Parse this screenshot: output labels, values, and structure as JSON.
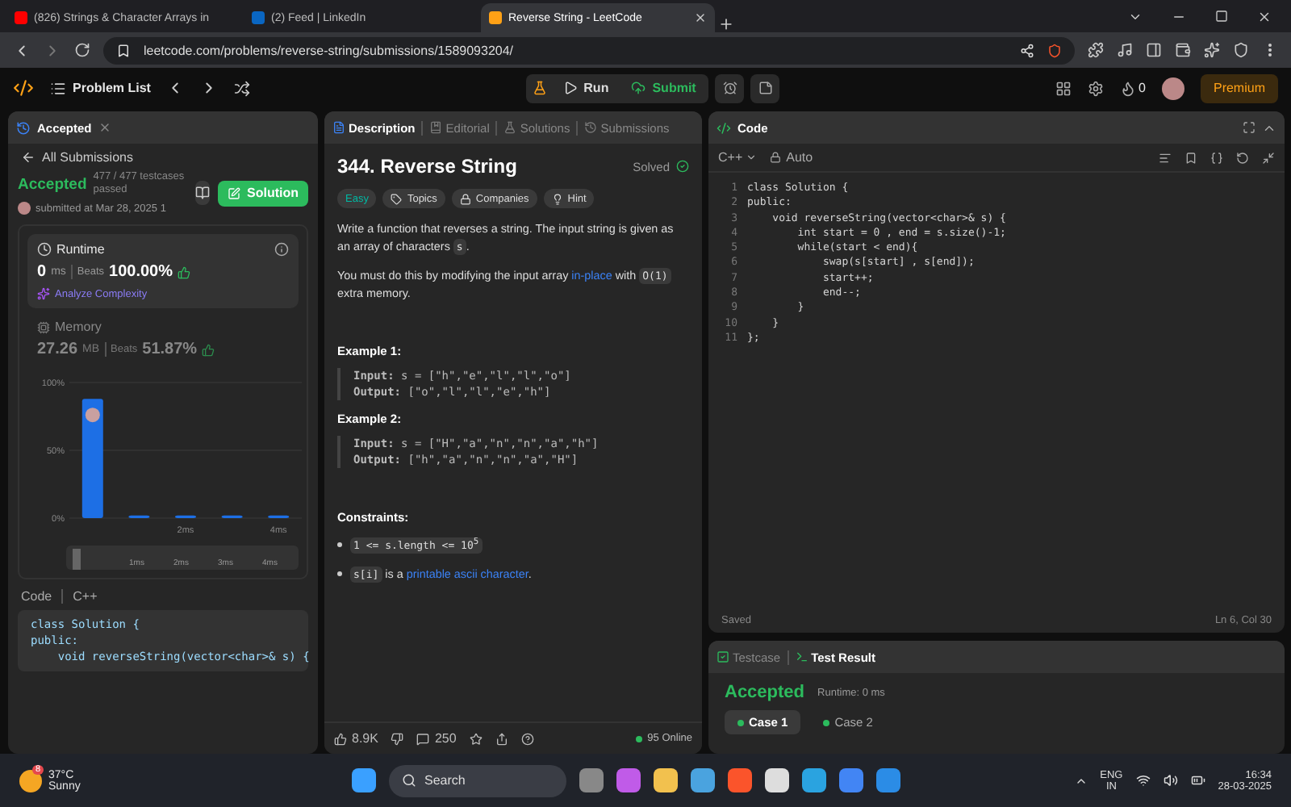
{
  "browser": {
    "tabs": [
      {
        "title": "(826) Strings & Character Arrays in",
        "selected": false
      },
      {
        "title": "(2) Feed | LinkedIn",
        "selected": false
      },
      {
        "title": "Reverse String - LeetCode",
        "selected": true
      }
    ],
    "url": "leetcode.com/problems/reverse-string/submissions/1589093204/"
  },
  "topbar": {
    "problem_list": "Problem List",
    "run": "Run",
    "submit": "Submit",
    "streak": "0",
    "premium": "Premium"
  },
  "submission": {
    "tab": "Accepted",
    "back": "All Submissions",
    "status": "Accepted",
    "testcases": "477 / 477 testcases passed",
    "submitted": "submitted at Mar 28, 2025 1",
    "solution": "Solution",
    "runtime": {
      "title": "Runtime",
      "value": "0",
      "unit": "ms",
      "beats_label": "Beats",
      "beats": "100.00%",
      "analyze": "Analyze Complexity"
    },
    "memory": {
      "title": "Memory",
      "value": "27.26",
      "unit": "MB",
      "beats_label": "Beats",
      "beats": "51.87%"
    },
    "chart_data": {
      "type": "bar",
      "values": [
        88,
        2,
        2,
        2,
        2
      ],
      "categories": [
        null,
        null,
        "2ms",
        null,
        "4ms"
      ],
      "yticks": [
        {
          "value": 0,
          "label": "0%"
        },
        {
          "value": 50,
          "label": "50%"
        },
        {
          "value": 100,
          "label": "100%"
        }
      ],
      "ylim": [
        0,
        100
      ]
    },
    "range_labels": [
      "1ms",
      "2ms",
      "3ms",
      "4ms"
    ],
    "code_tabs": [
      "Code",
      "C++"
    ],
    "code_lines": [
      "class Solution {",
      "public:",
      "    void reverseString(vector<char>& s) {"
    ]
  },
  "description": {
    "tabs": [
      {
        "label": "Description",
        "selected": true
      },
      {
        "label": "Editorial",
        "selected": false
      },
      {
        "label": "Solutions",
        "selected": false
      },
      {
        "label": "Submissions",
        "selected": false
      }
    ],
    "title": "344. Reverse String",
    "solved": "Solved",
    "tags": [
      {
        "label": "Easy",
        "kind": "difficulty"
      },
      {
        "label": "Topics",
        "kind": "topics"
      },
      {
        "label": "Companies",
        "kind": "companies"
      },
      {
        "label": "Hint",
        "kind": "hint"
      }
    ],
    "paragraphs": [
      [
        {
          "kind": "text",
          "text": "Write a function that reverses a string. The input string is given as an array of characters "
        },
        {
          "kind": "code",
          "text": "s"
        },
        {
          "kind": "text",
          "text": "."
        }
      ],
      [
        {
          "kind": "text",
          "text": "You must do this by modifying the input array "
        },
        {
          "kind": "link",
          "text": "in-place"
        },
        {
          "kind": "text",
          "text": " with "
        },
        {
          "kind": "code",
          "text": "O(1)"
        },
        {
          "kind": "text",
          "text": " extra memory."
        }
      ]
    ],
    "examples": [
      {
        "title": "Example 1:",
        "input_label": "Input:",
        "input": "s = [\"h\",\"e\",\"l\",\"l\",\"o\"]",
        "output_label": "Output:",
        "output": "[\"o\",\"l\",\"l\",\"e\",\"h\"]"
      },
      {
        "title": "Example 2:",
        "input_label": "Input:",
        "input": "s = [\"H\",\"a\",\"n\",\"n\",\"a\",\"h\"]",
        "output_label": "Output:",
        "output": "[\"h\",\"a\",\"n\",\"n\",\"a\",\"H\"]"
      }
    ],
    "constraints_title": "Constraints:",
    "constraints": [
      [
        {
          "kind": "code",
          "text": "1 <= s.length <= 10$^{5}$"
        }
      ],
      [
        {
          "kind": "code",
          "text": "s[i]"
        },
        {
          "kind": "text",
          "text": " is a "
        },
        {
          "kind": "link",
          "text": "printable ascii character"
        },
        {
          "kind": "text",
          "text": "."
        }
      ]
    ],
    "likes": "8.9K",
    "comments": "250",
    "online": "95 Online"
  },
  "editor": {
    "title": "Code",
    "language": "C++",
    "mode": "Auto",
    "lines": [
      {
        "number": "1",
        "text": "class Solution {"
      },
      {
        "number": "2",
        "text": "public:"
      },
      {
        "number": "3",
        "text": "    void reverseString(vector<char>& s) {"
      },
      {
        "number": "4",
        "text": "        int start = 0 , end = s.size()-1;"
      },
      {
        "number": "5",
        "text": "        while(start < end){"
      },
      {
        "number": "6",
        "text": "            swap(s[start] , s[end]);"
      },
      {
        "number": "7",
        "text": "            start++;"
      },
      {
        "number": "8",
        "text": "            end--;"
      },
      {
        "number": "9",
        "text": "        }"
      },
      {
        "number": "10",
        "text": "    }"
      },
      {
        "number": "11",
        "text": "};"
      }
    ],
    "status": "Saved",
    "cursor": "Ln 6, Col 30"
  },
  "result": {
    "tabs": [
      {
        "label": "Testcase",
        "selected": false
      },
      {
        "label": "Test Result",
        "selected": true
      }
    ],
    "status": "Accepted",
    "runtime": "Runtime: 0 ms",
    "cases": [
      {
        "label": "Case 1",
        "selected": true
      },
      {
        "label": "Case 2",
        "selected": false
      }
    ]
  },
  "taskbar": {
    "temperature": "37°C",
    "weather": "Sunny",
    "weather_badge": "8",
    "search": "Search",
    "lang": "ENG",
    "region": "IN",
    "time": "16:34",
    "date": "28-03-2025"
  }
}
